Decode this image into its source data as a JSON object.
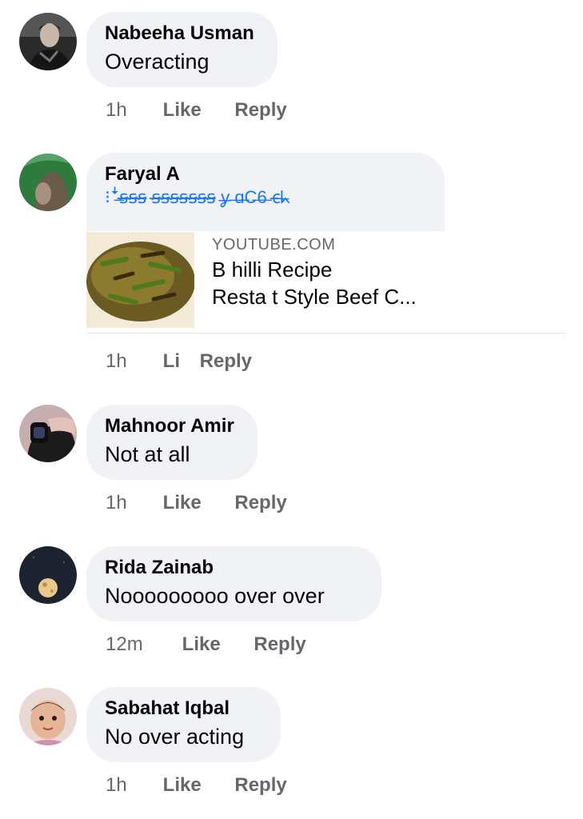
{
  "comments": [
    {
      "name": "Nabeeha Usman",
      "text": "Overacting",
      "time": "1h",
      "like": "Like",
      "reply": "Reply",
      "avatar_icon": "profile-photo-man-dark"
    },
    {
      "name": "Faryal A",
      "text": "",
      "time": "1h",
      "like": "Li",
      "reply": "Reply",
      "avatar_icon": "profile-photo-green",
      "link_preview": {
        "domain": "YOUTUBE.COM",
        "title_line1": "B   hilli Recipe",
        "title_line2": "Resta   t Style Beef C...",
        "thumb_icon": "beef-chilli-food-image"
      }
    },
    {
      "name": "Mahnoor Amir",
      "text": "Not at all",
      "time": "1h",
      "like": "Like",
      "reply": "Reply",
      "avatar_icon": "profile-photo-hand-watch"
    },
    {
      "name": "Rida Zainab",
      "text": "Nooooooooo over over",
      "time": "12m",
      "like": "Like",
      "reply": "Reply",
      "avatar_icon": "profile-photo-moon-dark"
    },
    {
      "name": "Sabahat Iqbal",
      "text": "No over acting",
      "time": "1h",
      "like": "Like",
      "reply": "Reply",
      "avatar_icon": "profile-photo-baby"
    }
  ],
  "colors": {
    "bubble": "#f0f2f5",
    "meta_text": "#65676b",
    "link_blue": "#1877f2"
  }
}
